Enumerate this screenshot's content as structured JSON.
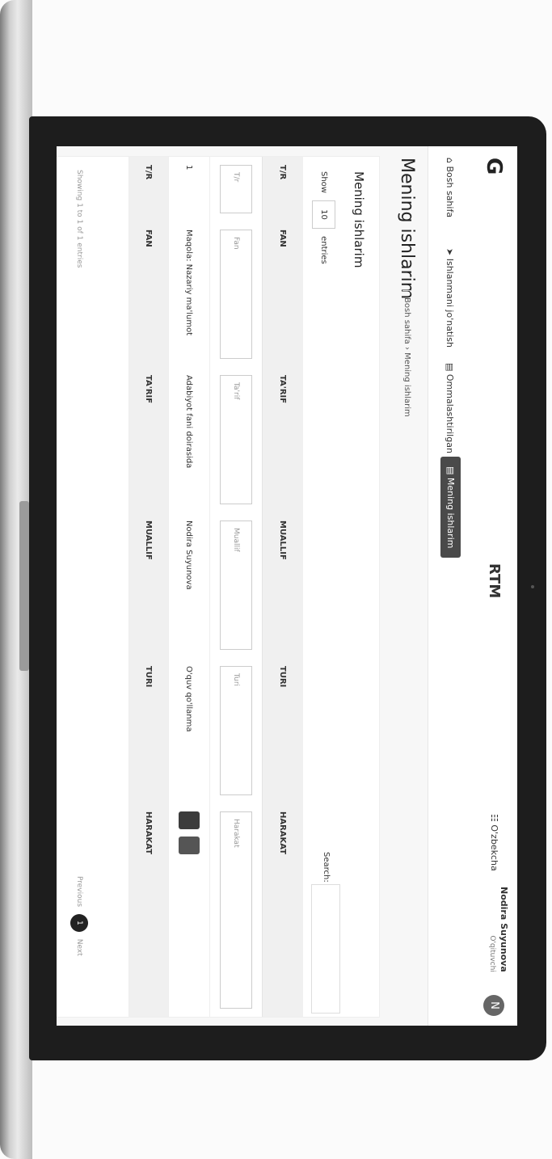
{
  "header": {
    "logo": "G",
    "brand": "RTM",
    "language": "O'zbekcha",
    "user_name": "Nodira Suyunova",
    "user_role": "O'qituvchi",
    "avatar_letter": "N"
  },
  "nav": {
    "items": [
      {
        "label": "Bosh sahifa",
        "icon": "home-icon"
      },
      {
        "label": "Ishlanmani jo'natish",
        "icon": "send-icon"
      },
      {
        "label": "Ommalashtirilgan",
        "icon": "list-icon"
      },
      {
        "label": "Mening ishlarim",
        "icon": "list-icon",
        "active": true
      }
    ]
  },
  "page": {
    "title": "Mening ishlarim",
    "breadcrumb": "Bosh sahifa  ›  Mening ishlarim"
  },
  "card": {
    "title": "Mening ishlarim",
    "show_label": "Show",
    "show_value": "10",
    "entries_label": "entries",
    "search_label": "Search:"
  },
  "table": {
    "headers": [
      "T/R",
      "FAN",
      "TA'RIF",
      "MUALLIF",
      "TURI",
      "HARAKAT"
    ],
    "filters": [
      "T/r",
      "Fan",
      "Ta'rif",
      "Muallif",
      "Turi",
      "Harakat"
    ],
    "rows": [
      {
        "tr": "1",
        "fan": "Maqola: Nazariy ma'lumot",
        "tarif": "Adabiyot fani doirasida",
        "muallif": "Nodira Suyunova",
        "turi": "O'quv qo'llanma"
      }
    ],
    "footer": [
      "T/R",
      "FAN",
      "TA'RIF",
      "MUALLIF",
      "TURI",
      "HARAKAT"
    ]
  },
  "footer": {
    "info": "Showing 1 to 1 of 1 entries",
    "prev": "Previous",
    "page": "1",
    "next": "Next"
  },
  "colors": {
    "active_nav": "#4a4a4a",
    "bezel": "#1d1d1d"
  }
}
